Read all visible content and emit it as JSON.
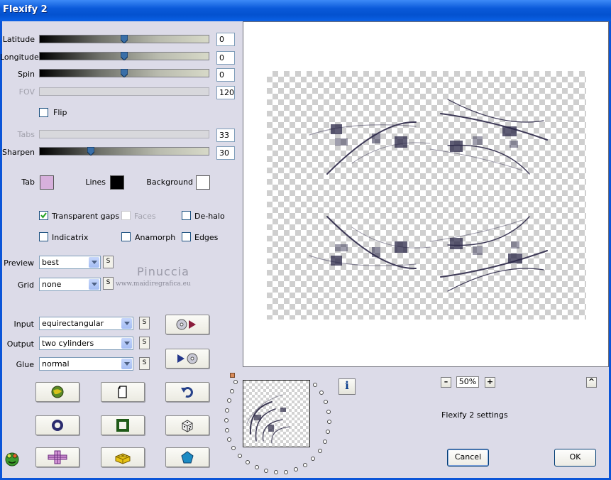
{
  "window": {
    "title": "Flexify 2"
  },
  "sliders": [
    {
      "label": "Latitude",
      "value": "0",
      "enabled": true,
      "level": 0.5
    },
    {
      "label": "Longitude",
      "value": "0",
      "enabled": true,
      "level": 0.5
    },
    {
      "label": "Spin",
      "value": "0",
      "enabled": true,
      "level": 0.5
    },
    {
      "label": "FOV",
      "value": "120",
      "enabled": false
    },
    {
      "label": "Tabs",
      "value": "33",
      "enabled": false
    },
    {
      "label": "Sharpen",
      "value": "30",
      "enabled": true,
      "level": 0.3
    }
  ],
  "flip": {
    "label": "Flip",
    "checked": false
  },
  "colors": {
    "tab": {
      "label": "Tab",
      "color": "#d7b0dc"
    },
    "lines": {
      "label": "Lines",
      "color": "#000000"
    },
    "background": {
      "label": "Background",
      "color": "#ffffff"
    }
  },
  "options": {
    "transparent_gaps": {
      "label": "Transparent gaps",
      "checked": true
    },
    "faces": {
      "label": "Faces",
      "checked": false,
      "enabled": false
    },
    "de_halo": {
      "label": "De-halo",
      "checked": false
    },
    "indicatrix": {
      "label": "Indicatrix",
      "checked": false
    },
    "anamorph": {
      "label": "Anamorph",
      "checked": false
    },
    "edges": {
      "label": "Edges",
      "checked": false
    }
  },
  "preview_select": {
    "label": "Preview",
    "value": "best"
  },
  "grid_select": {
    "label": "Grid",
    "value": "none"
  },
  "input_select": {
    "label": "Input",
    "value": "equirectangular"
  },
  "output_select": {
    "label": "Output",
    "value": "two cylinders"
  },
  "glue_select": {
    "label": "Glue",
    "value": "normal"
  },
  "s_button_label": "S",
  "watermark": {
    "name": "Pinuccia",
    "site": "www.maidiregrafica.eu"
  },
  "zoom": {
    "value": "50%",
    "minus": "–",
    "plus": "+"
  },
  "info_label": "i",
  "collapse_label": "^",
  "settings_label": "Flexify 2 settings",
  "cancel_label": "Cancel",
  "ok_label": "OK",
  "icons": [
    "globe-icon",
    "page-icon",
    "undo-icon",
    "ring-icon",
    "square-frame-icon",
    "dice-icon",
    "cross-icon",
    "lego-brick-icon",
    "pentagon-icon",
    "frog-logo-icon"
  ]
}
